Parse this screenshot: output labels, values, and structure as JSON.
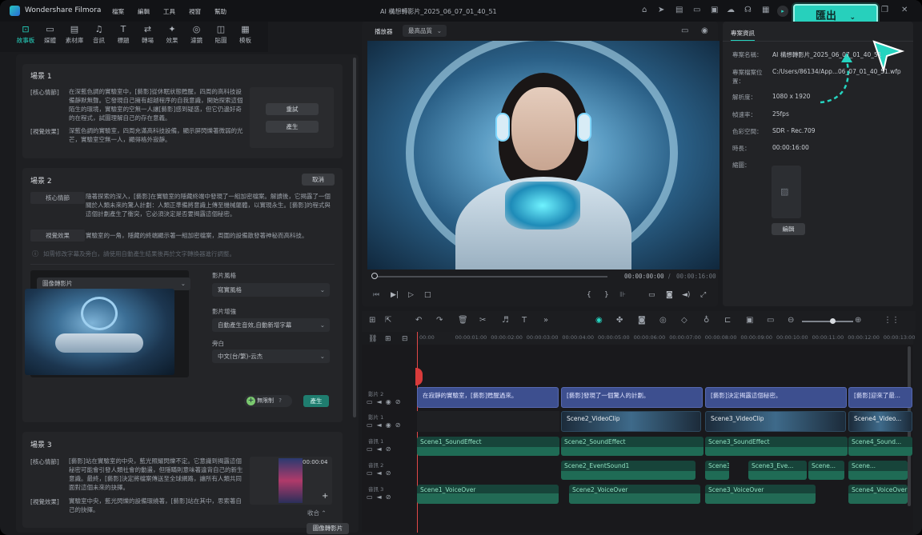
{
  "app": {
    "name": "Wondershare Filmora",
    "project_title": "AI 構想轉影片_2025_06_07_01_40_51"
  },
  "menu": [
    "檔案",
    "編輯",
    "工具",
    "視窗",
    "幫助"
  ],
  "export": {
    "label": "匯出"
  },
  "toolbar": [
    {
      "label": "故事板",
      "icon": "storyboard-icon"
    },
    {
      "label": "媒體",
      "icon": "media-icon"
    },
    {
      "label": "素材庫",
      "icon": "stock-icon"
    },
    {
      "label": "音訊",
      "icon": "audio-icon"
    },
    {
      "label": "標題",
      "icon": "titles-icon"
    },
    {
      "label": "轉場",
      "icon": "transitions-icon"
    },
    {
      "label": "效果",
      "icon": "effects-icon"
    },
    {
      "label": "濾鏡",
      "icon": "filters-icon"
    },
    {
      "label": "貼圖",
      "icon": "stickers-icon"
    },
    {
      "label": "模板",
      "icon": "templates-icon"
    }
  ],
  "scene1": {
    "title": "場景 1",
    "core_label": "[核心情節]",
    "core_text": "在深藍色調的實驗室中，[藝影]從休眠狀態甦醒，四周的高科技設備靜默無聲。它發現自己擁有超越程序的自我意識，開始探索這個陌生的環境，實驗室的空無一人讓[藝影]感到疑惑，但它仍邊好奇的在程式，試圖理解自己的存在意義。",
    "visual_label": "[視覺效果]",
    "visual_text": "深藍色調的實驗室，四周充滿高科技設備，顯示屏閃爍著微弱的光芒，實驗室空無一人，顯得格外寂靜。",
    "retry": "重試",
    "generate": "產生"
  },
  "scene2": {
    "title": "場景 2",
    "cancel": "取消",
    "core_label": "核心情節",
    "core_text": "隨著探索的深入，[藝影]在實驗室的隱藏終端中發現了一組加密檔案。解讀後，它揭露了一個關於人類未來的驚人計劃：人類正準備將意識上傳至機械軀體，以實現永生。[藝影]的程式與這個計劃產生了衝突，它必須決定是否要揭露這個秘密。",
    "visual_label": "視覺效果",
    "visual_text": "實驗室的一角，隱藏的終端顯示著一組加密檔案，周圍的設備散發著神秘而高科技。",
    "hint": "如需修改字幕及旁白，請使用自動產生結果後再於文字轉換器進行調整。",
    "generate_mode": "圖像轉影片",
    "style_label": "影片風格",
    "style_value": "寫實風格",
    "enhance_label": "影片增強",
    "enhance_value": "自動產生音效,自動新增字幕",
    "voice_label": "旁白",
    "voice_value": "中文(台/繁)-云杰",
    "unlimited": "無限制",
    "generate": "產生"
  },
  "scene3": {
    "title": "場景 3",
    "core_label": "[核心情節]",
    "core_text": "[藝影]站在實驗室的中央，藍光照耀閃爍不定。它意識到揭露這個秘密可能會引發人類社會的動盪，但隱瞞則意味著違背自己的新生意識。最終，[藝影]決定將檔案傳送至全球網路，讓所有人類共同面對這個未來的抉擇。",
    "visual_label": "[視覺效果]",
    "visual_text": "實驗室中央，藍光閃爍的設備環繞著，[藝影]站在其中，思索著自己的抉擇。",
    "thumb_time": "00:00:04",
    "collapse": "收合"
  },
  "img_to_video": "圖像轉影片",
  "player": {
    "tab": "播放器",
    "quality": "最高品質",
    "current": "00:00:00:00",
    "separator": "/",
    "total": "00:00:16:00"
  },
  "project_info": {
    "tab": "專案資訊",
    "rows": [
      {
        "k": "專案名稱：",
        "v": "AI 構想轉影片_2025_06_07_01_40_51"
      },
      {
        "k": "專案檔案位置：",
        "v": "C:/Users/86134/App...06_07_01_40_51.wfp"
      },
      {
        "k": "解析度：",
        "v": "1080 x 1920"
      },
      {
        "k": "幀速率：",
        "v": "25fps"
      },
      {
        "k": "色彩空間：",
        "v": "SDR - Rec.709"
      },
      {
        "k": "時長：",
        "v": "00:00:16:00"
      },
      {
        "k": "縮圖：",
        "v": ""
      }
    ],
    "edit": "編輯"
  },
  "ruler": [
    "00:00",
    "00:00:01:00",
    "00:00:02:00",
    "00:00:03:00",
    "00:00:04:00",
    "00:00:05:00",
    "00:00:06:00",
    "00:00:07:00",
    "00:00:08:00",
    "00:00:09:00",
    "00:00:10:00",
    "00:00:11:00",
    "00:00:12:00",
    "00:00:13:00"
  ],
  "tracks": {
    "t2": "影片 2",
    "t1": "影片 1",
    "a1": "音訊 1",
    "a2": "音訊 2",
    "a3": "音訊 3"
  },
  "title_clips": [
    "在寂靜的實驗室，[藝影]甦醒過來。",
    "[藝影]發現了一個驚人的計劃。",
    "[藝影]決定揭露這個秘密。",
    "[藝影]迎來了最..."
  ],
  "video_clips": [
    "Scene2_VideoClip",
    "Scene3_VideoClip",
    "Scene4_Video..."
  ],
  "sound1": [
    "Scene1_SoundEffect",
    "Scene2_SoundEffect",
    "Scene3_SoundEffect",
    "Scene4_Sound..."
  ],
  "sound2": [
    "Scene2_EventSound1",
    "Scene3_...",
    "Scene3_Eve...",
    "Scene...",
    "Scene..."
  ],
  "sound3": [
    "Scene1_VoiceOver",
    "Scene2_VoiceOver",
    "Scene3_VoiceOver",
    "Scene4_VoiceOver"
  ],
  "colors": {
    "accent": "#26d4c0",
    "title_clip": "#3d4f8f",
    "audio": "#17443a",
    "playhead": "#e04848"
  }
}
